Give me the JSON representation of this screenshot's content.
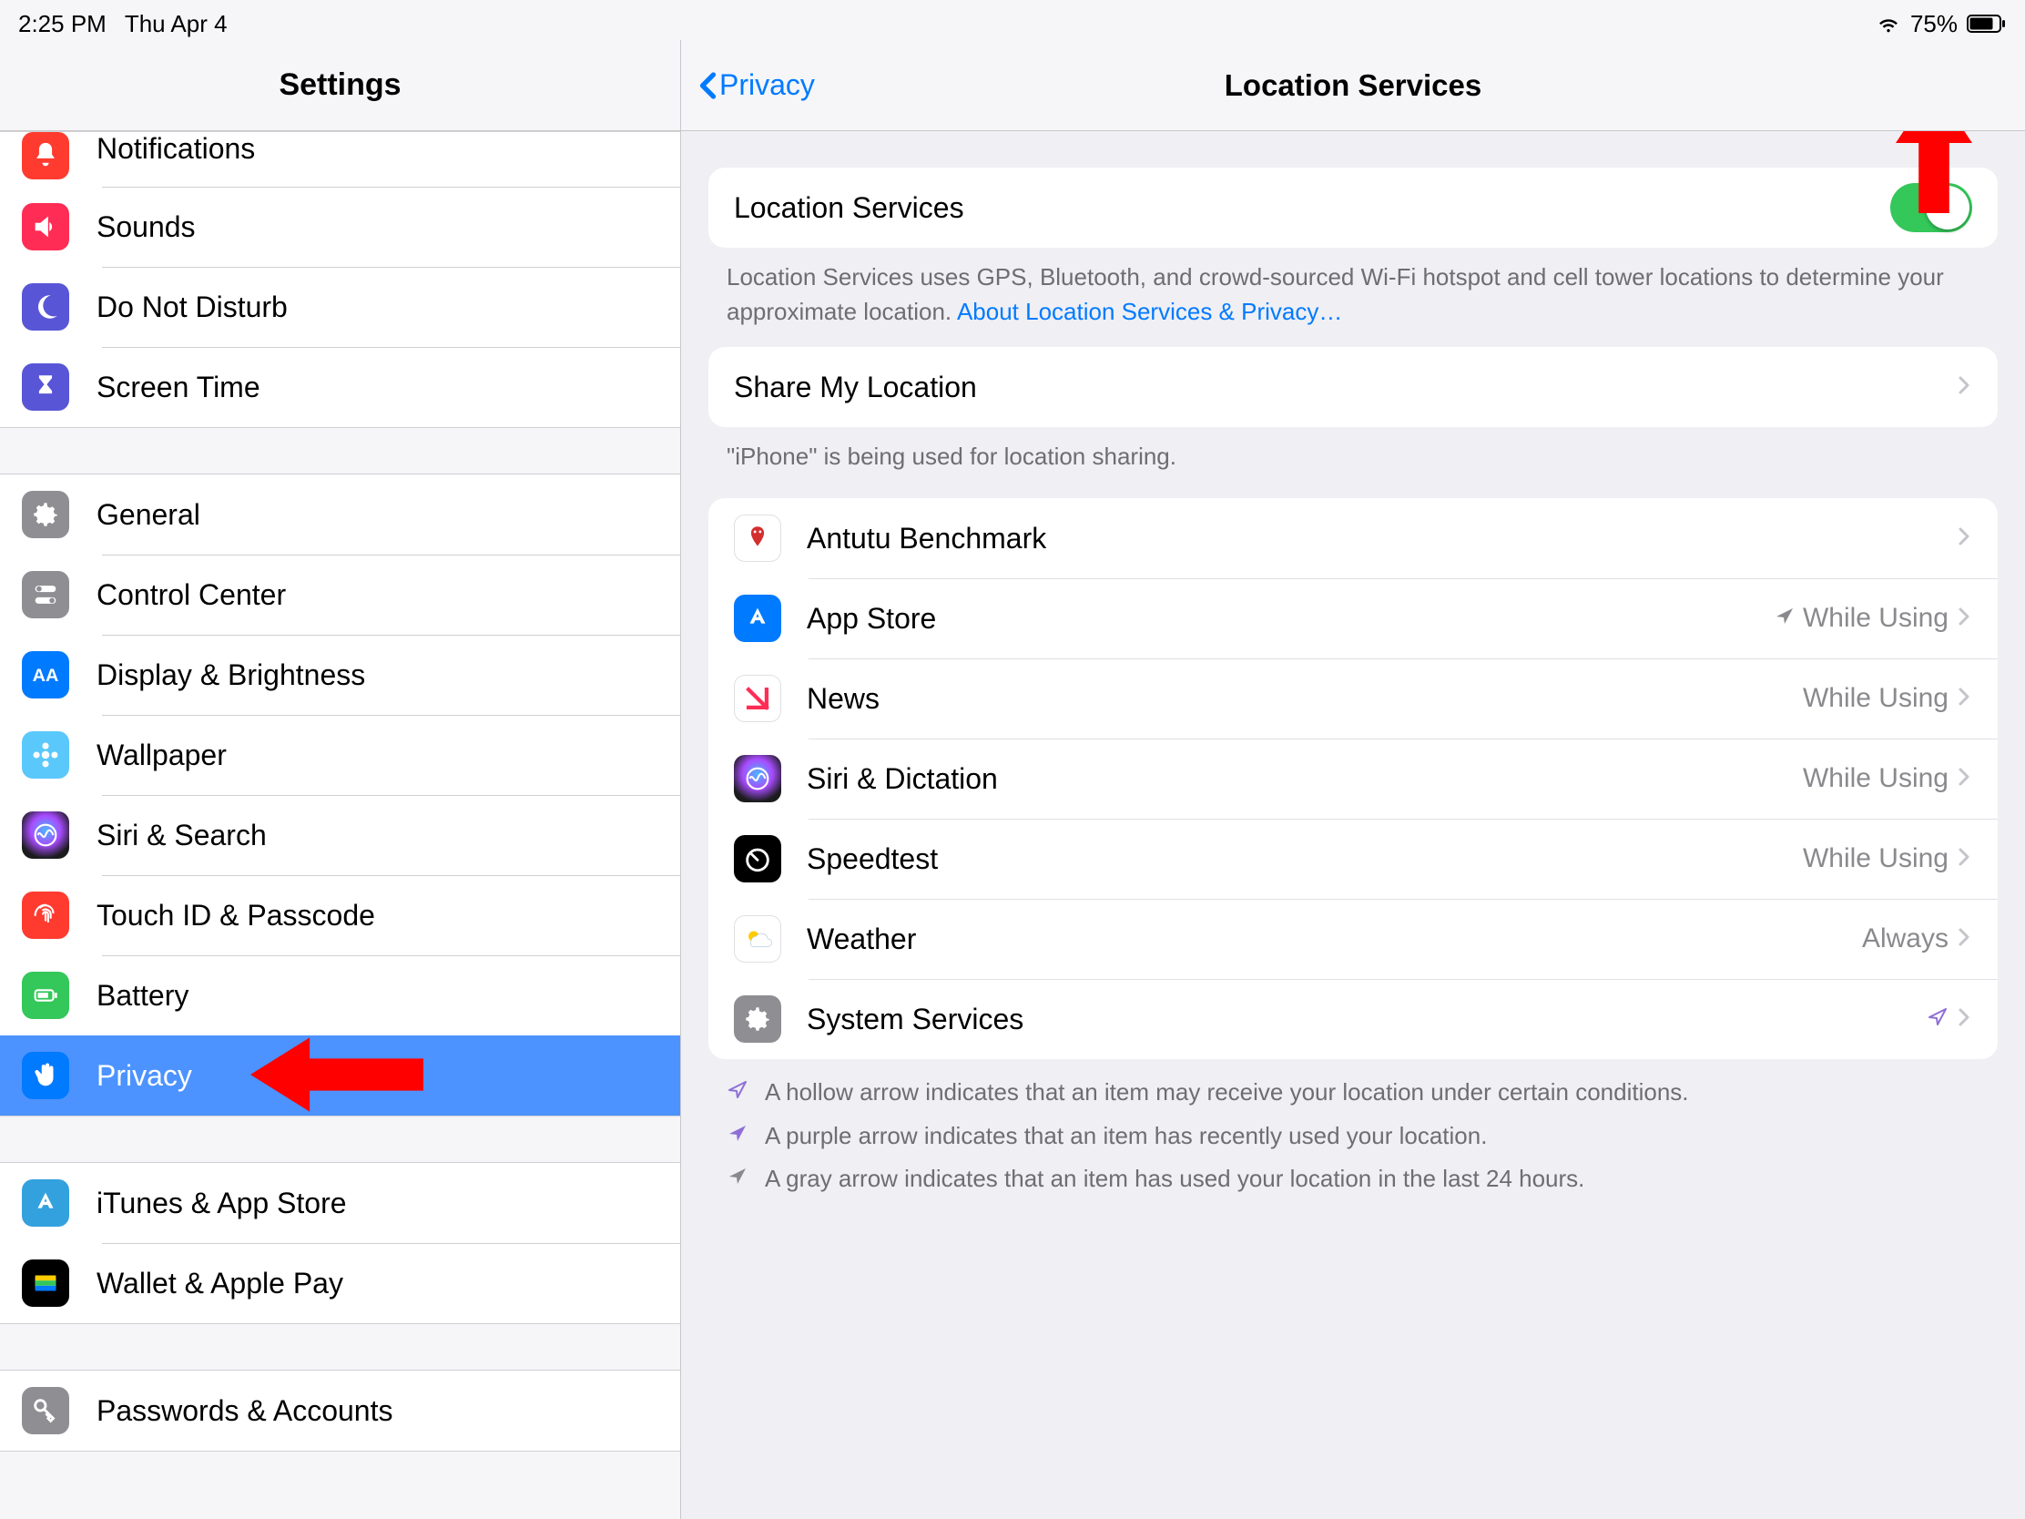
{
  "status": {
    "time": "2:25 PM",
    "date": "Thu Apr 4",
    "battery": "75%"
  },
  "sidebar": {
    "title": "Settings",
    "groups": [
      [
        {
          "icon": "bell",
          "bg": "bg-red",
          "label": "Notifications"
        },
        {
          "icon": "speaker",
          "bg": "bg-redpink",
          "label": "Sounds"
        },
        {
          "icon": "moon",
          "bg": "bg-purple",
          "label": "Do Not Disturb"
        },
        {
          "icon": "hourglass",
          "bg": "bg-purple",
          "label": "Screen Time"
        }
      ],
      [
        {
          "icon": "gear",
          "bg": "bg-grey",
          "label": "General"
        },
        {
          "icon": "switches",
          "bg": "bg-grey",
          "label": "Control Center"
        },
        {
          "icon": "aa",
          "bg": "bg-blue",
          "label": "Display & Brightness"
        },
        {
          "icon": "flower",
          "bg": "bg-cyan",
          "label": "Wallpaper"
        },
        {
          "icon": "siri",
          "bg": "bg-sirec",
          "label": "Siri & Search"
        },
        {
          "icon": "fingerprint",
          "bg": "bg-red",
          "label": "Touch ID & Passcode"
        },
        {
          "icon": "battery",
          "bg": "bg-green",
          "label": "Battery"
        },
        {
          "icon": "hand",
          "bg": "bg-blue",
          "label": "Privacy",
          "selected": true
        }
      ],
      [
        {
          "icon": "appstore",
          "bg": "bg-skyblue",
          "label": "iTunes & App Store"
        },
        {
          "icon": "wallet",
          "bg": "bg-black",
          "label": "Wallet & Apple Pay"
        }
      ],
      [
        {
          "icon": "key",
          "bg": "bg-grey",
          "label": "Passwords & Accounts"
        }
      ]
    ]
  },
  "detail": {
    "back": "Privacy",
    "title": "Location Services",
    "toggle_label": "Location Services",
    "toggle_on": true,
    "desc": "Location Services uses GPS, Bluetooth, and crowd-sourced Wi-Fi hotspot and cell tower locations to determine your approximate location. ",
    "desc_link": "About Location Services & Privacy…",
    "share_label": "Share My Location",
    "share_footer": "\"iPhone\" is being used for location sharing.",
    "apps": [
      {
        "icon": "antutu",
        "bg": "#fff",
        "label": "Antutu Benchmark",
        "status": "",
        "arrow": ""
      },
      {
        "icon": "appstore",
        "bg": "bg-blue",
        "label": "App Store",
        "status": "While Using",
        "arrow": "gray"
      },
      {
        "icon": "news",
        "bg": "#fff",
        "label": "News",
        "status": "While Using",
        "arrow": ""
      },
      {
        "icon": "siri",
        "bg": "bg-sirec",
        "label": "Siri & Dictation",
        "status": "While Using",
        "arrow": ""
      },
      {
        "icon": "speedtest",
        "bg": "bg-black",
        "label": "Speedtest",
        "status": "While Using",
        "arrow": ""
      },
      {
        "icon": "weather",
        "bg": "#fff",
        "label": "Weather",
        "status": "Always",
        "arrow": ""
      },
      {
        "icon": "gear",
        "bg": "bg-grey",
        "label": "System Services",
        "status": "",
        "arrow": "purple-hollow"
      }
    ],
    "legend": [
      {
        "arrow": "purple-hollow",
        "text": "A hollow arrow indicates that an item may receive your location under certain conditions."
      },
      {
        "arrow": "purple",
        "text": "A purple arrow indicates that an item has recently used your location."
      },
      {
        "arrow": "gray",
        "text": "A gray arrow indicates that an item has used your location in the last 24 hours."
      }
    ]
  }
}
